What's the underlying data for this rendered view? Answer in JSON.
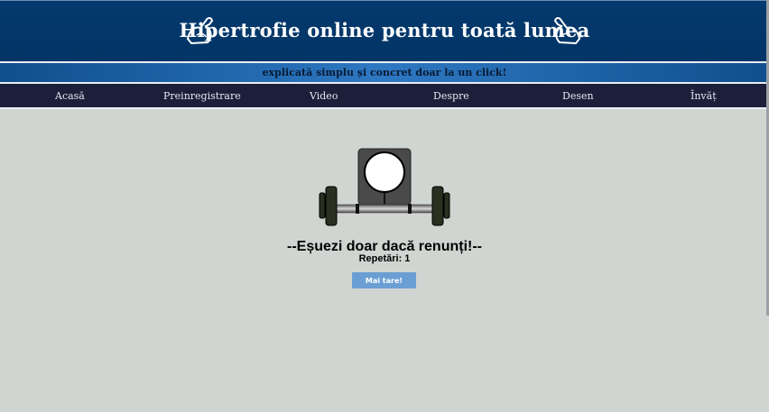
{
  "header": {
    "title": "Hipertrofie online pentru toată lumea",
    "left_icon": "flexed-biceps-icon",
    "right_icon": "flexed-biceps-icon",
    "background": "#043a6e"
  },
  "subheader": {
    "text": "explicată simplu și concret doar la un click!"
  },
  "nav": {
    "items": [
      {
        "label": "Acasă"
      },
      {
        "label": "Preinregistrare"
      },
      {
        "label": "Video"
      },
      {
        "label": "Despre"
      },
      {
        "label": "Desen"
      },
      {
        "label": "Învăț"
      }
    ]
  },
  "main": {
    "drawing_icon": "weightlifter-barbell-icon",
    "motto": "--Eșuezi doar dacă renunți!--",
    "reps_text": "Repetări: 1",
    "button_label": "Mai tare!",
    "button_color": "#6b9fd3"
  }
}
